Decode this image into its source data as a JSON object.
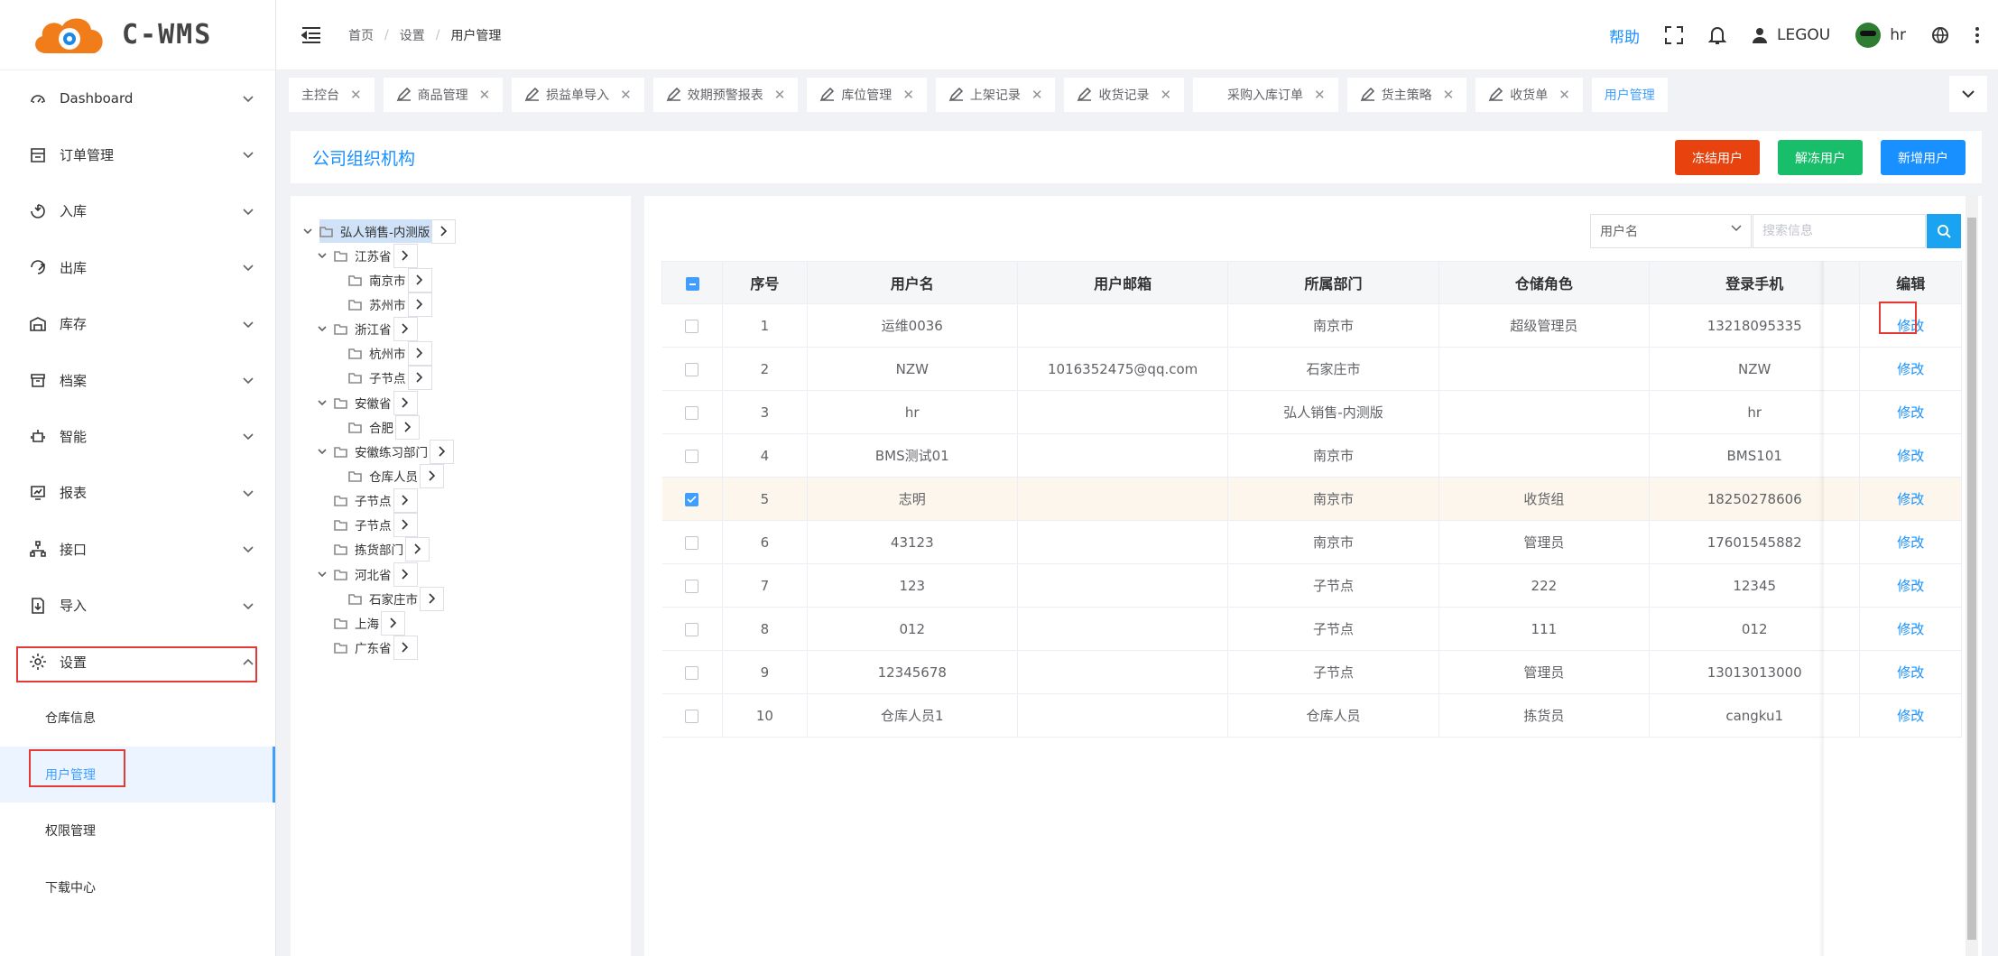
{
  "app": {
    "brand": "C-WMS"
  },
  "sidebar": {
    "items": [
      {
        "label": "Dashboard",
        "icon": "dashboard-icon"
      },
      {
        "label": "订单管理",
        "icon": "order-icon"
      },
      {
        "label": "入库",
        "icon": "inbound-icon"
      },
      {
        "label": "出库",
        "icon": "outbound-icon"
      },
      {
        "label": "库存",
        "icon": "stock-icon"
      },
      {
        "label": "档案",
        "icon": "archive-icon"
      },
      {
        "label": "智能",
        "icon": "robot-icon"
      },
      {
        "label": "报表",
        "icon": "report-icon"
      },
      {
        "label": "接口",
        "icon": "api-icon"
      },
      {
        "label": "导入",
        "icon": "import-icon"
      },
      {
        "label": "设置",
        "icon": "settings-icon"
      }
    ],
    "sub_items": [
      "仓库信息",
      "用户管理",
      "权限管理",
      "下载中心"
    ]
  },
  "header": {
    "breadcrumb": [
      "首页",
      "设置",
      "用户管理"
    ],
    "help": "帮助",
    "warehouse": "LEGOU",
    "user": "hr"
  },
  "tabs": [
    {
      "label": "主控台",
      "icon": false
    },
    {
      "label": "商品管理",
      "icon": true
    },
    {
      "label": "损益单导入",
      "icon": true
    },
    {
      "label": "效期预警报表",
      "icon": true
    },
    {
      "label": "库位管理",
      "icon": true
    },
    {
      "label": "上架记录",
      "icon": true
    },
    {
      "label": "收货记录",
      "icon": true
    },
    {
      "label": "采购入库订单",
      "icon": false
    },
    {
      "label": "货主策略",
      "icon": true
    },
    {
      "label": "收货单",
      "icon": true
    },
    {
      "label": "用户管理",
      "icon": false
    }
  ],
  "page": {
    "title": "公司组织机构",
    "buttons": {
      "freeze": "冻结用户",
      "unfreeze": "解冻用户",
      "add": "新增用户"
    }
  },
  "tree": {
    "nodes": [
      "弘人销售-内测版",
      "江苏省",
      "南京市",
      "苏州市",
      "浙江省",
      "杭州市",
      "子节点",
      "安徽省",
      "合肥",
      "安徽练习部门",
      "仓库人员",
      "子节点",
      "子节点",
      "拣货部门",
      "河北省",
      "石家庄市",
      "上海",
      "广东省"
    ]
  },
  "search": {
    "field": "用户名",
    "placeholder": "搜索信息"
  },
  "table": {
    "columns": [
      "序号",
      "用户名",
      "用户邮箱",
      "所属部门",
      "仓储角色",
      "登录手机",
      "编辑"
    ],
    "edit_label": "修改",
    "rows": [
      {
        "no": "1",
        "name": "运维0036",
        "email": "",
        "dept": "南京市",
        "role": "超级管理员",
        "phone": "13218095335",
        "checked": false
      },
      {
        "no": "2",
        "name": "NZW",
        "email": "1016352475@qq.com",
        "dept": "石家庄市",
        "role": "",
        "phone": "NZW",
        "checked": false
      },
      {
        "no": "3",
        "name": "hr",
        "email": "",
        "dept": "弘人销售-内测版",
        "role": "",
        "phone": "hr",
        "checked": false
      },
      {
        "no": "4",
        "name": "BMS测试01",
        "email": "",
        "dept": "南京市",
        "role": "",
        "phone": "BMS101",
        "checked": false
      },
      {
        "no": "5",
        "name": "志明",
        "email": "",
        "dept": "南京市",
        "role": "收货组",
        "phone": "18250278606",
        "checked": true
      },
      {
        "no": "6",
        "name": "43123",
        "email": "",
        "dept": "南京市",
        "role": "管理员",
        "phone": "17601545882",
        "checked": false
      },
      {
        "no": "7",
        "name": "123",
        "email": "",
        "dept": "子节点",
        "role": "222",
        "phone": "12345",
        "checked": false
      },
      {
        "no": "8",
        "name": "012",
        "email": "",
        "dept": "子节点",
        "role": "111",
        "phone": "012",
        "checked": false
      },
      {
        "no": "9",
        "name": "12345678",
        "email": "",
        "dept": "子节点",
        "role": "管理员",
        "phone": "13013013000",
        "checked": false
      },
      {
        "no": "10",
        "name": "仓库人员1",
        "email": "",
        "dept": "仓库人员",
        "role": "拣货员",
        "phone": "cangku1",
        "checked": false
      }
    ]
  },
  "colors": {
    "accent": "#1890ff",
    "freeze": "#e8420f",
    "unfreeze": "#19be6b",
    "highlight": "#e53935"
  }
}
